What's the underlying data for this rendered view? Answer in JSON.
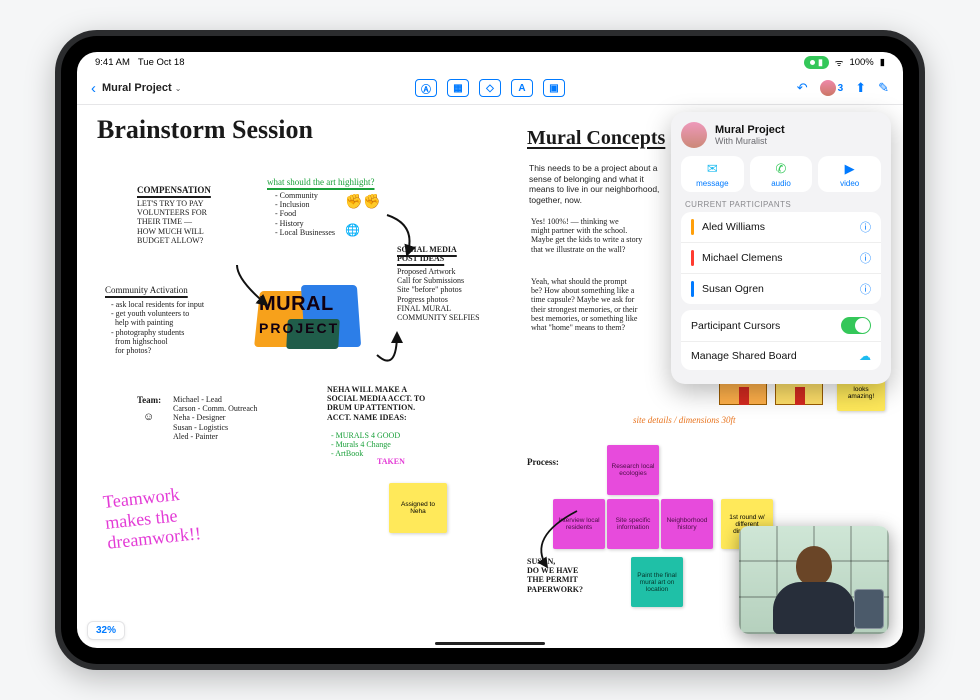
{
  "status": {
    "time": "9:41 AM",
    "date": "Tue Oct 18",
    "battery": "100%"
  },
  "appbar": {
    "doc_title": "Mural Project",
    "participant_count": "3"
  },
  "canvas": {
    "heading_left": "Brainstorm Session",
    "heading_right": "Mural Concepts",
    "compensation_h": "COMPENSATION",
    "compensation_b": "LET'S TRY TO PAY\nVOLUNTEERS FOR\nTHEIR TIME —\nHOW MUCH WILL\nBUDGET ALLOW?",
    "highlight_h": "what should the art highlight?",
    "highlight_list": "- Community\n- Inclusion\n- Food\n- History\n- Local Businesses",
    "community_h": "Community Activation",
    "community_b": "- ask local residents for input\n- get youth volunteers to\n  help with painting\n- photography students\n  from highschool\n  for photos?",
    "team_h": "Team:",
    "team_b": "Michael - Lead\nCarson - Comm. Outreach\nNeha - Designer\nSusan - Logistics\nAled - Painter",
    "post_h": "SOCIAL MEDIA\nPOST IDEAS",
    "post_b": "Proposed Artwork\nCall for Submissions\nSite \"before\" photos\nProgress photos\nFINAL MURAL\nCOMMUNITY SELFIES",
    "acct_b": "NEHA WILL MAKE A\nSOCIAL MEDIA ACCT. TO\nDRUM UP ATTENTION.\nACCT. NAME IDEAS:",
    "acct_ideas": "- MURALS 4 GOOD\n- Murals 4 Change\n- ArtBook",
    "acct_taken": "TAKEN",
    "teamwork": "Teamwork\nmakes the\ndreamwork!!",
    "mural_logo_1": "MURAL",
    "mural_logo_2": "PROJECT",
    "para": "This needs to be a project about a\nsense of belonging and what it\nmeans to live in our neighborhood,\ntogether, now.",
    "cursive1": "Yes! 100%! — thinking we\nmight partner with the school.\nMaybe get the kids to write a story\nthat we illustrate on the wall?",
    "cursive2": "Yeah, what should the prompt\nbe? How about something like a\ntime capsule? Maybe we ask for\ntheir strongest memories, or their\nbest memories, or something like\nwhat \"home\" means to them?",
    "site_note": "site details / dimensions 30ft",
    "wow_note": "Wow! This\nlooks amazing!",
    "process_h": "Process:",
    "susan_note": "SUSAN,\nDO WE HAVE\nTHE PERMIT\nPAPERWORK?",
    "sticky_assigned": "Assigned to\nNeha",
    "sticky_research": "Research local\necologies",
    "sticky_interview": "Interview\nlocal residents",
    "sticky_sitespec": "Site specific\ninformation",
    "sticky_neighborhood": "Neighborhood\nhistory",
    "sticky_round1": "1st round\nw/ different\ndirections",
    "sticky_final": "Paint the final\nmural art on\nlocation"
  },
  "popover": {
    "title": "Mural Project",
    "subtitle": "With Muralist",
    "btn_message": "message",
    "btn_audio": "audio",
    "btn_video": "video",
    "section": "CURRENT PARTICIPANTS",
    "p1": "Aled Williams",
    "p2": "Michael Clemens",
    "p3": "Susan Ogren",
    "row_cursors": "Participant Cursors",
    "row_manage": "Manage Shared Board"
  },
  "zoom": "32%"
}
